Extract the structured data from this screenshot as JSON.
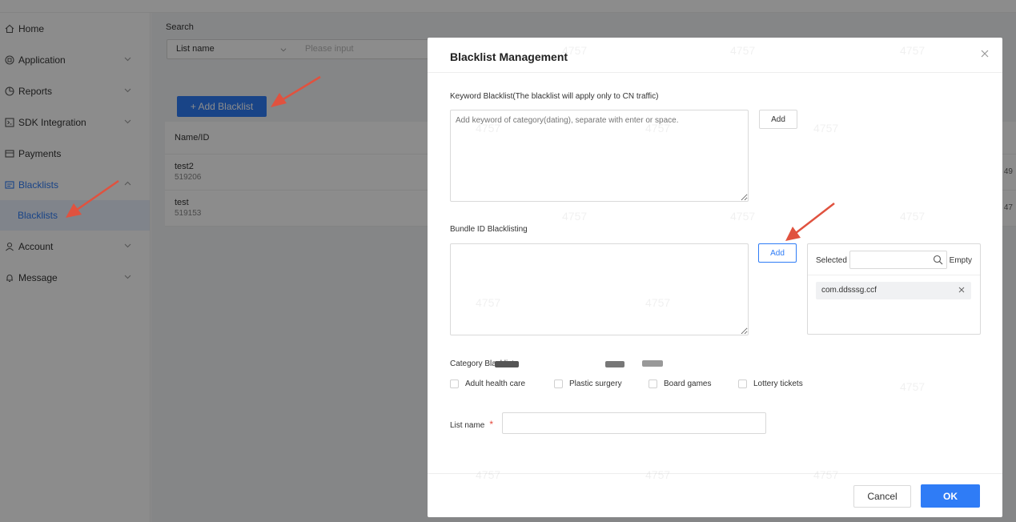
{
  "sidebar": {
    "items": [
      {
        "label": "Home",
        "icon": "home-icon"
      },
      {
        "label": "Application",
        "icon": "app-icon"
      },
      {
        "label": "Reports",
        "icon": "reports-icon"
      },
      {
        "label": "SDK Integration",
        "icon": "sdk-icon"
      },
      {
        "label": "Payments",
        "icon": "payments-icon"
      },
      {
        "label": "Blacklists",
        "icon": "blacklist-icon"
      },
      {
        "label": "Account",
        "icon": "account-icon"
      },
      {
        "label": "Message",
        "icon": "bell-icon"
      }
    ],
    "sub_item": "Blacklists"
  },
  "main": {
    "search_label": "Search",
    "filter_select": "List name",
    "filter_placeholder": "Please input",
    "add_button": "+ Add Blacklist",
    "table": {
      "header": "Name/ID",
      "rows": [
        {
          "name": "test2",
          "id": "519206",
          "tail": "49"
        },
        {
          "name": "test",
          "id": "519153",
          "tail": "47"
        }
      ]
    }
  },
  "modal": {
    "title": "Blacklist Management",
    "keyword_label": "Keyword Blacklist(The blacklist will apply only to CN traffic)",
    "keyword_placeholder": "Add keyword of category(dating), separate with enter or space.",
    "keyword_add": "Add",
    "bundle_label": "Bundle ID Blacklisting",
    "bundle_add": "Add",
    "selected_label": "Selected",
    "empty_label": "Empty",
    "selected_tags": [
      "com.ddsssg.ccf"
    ],
    "category_label": "Category Blacklist",
    "categories": [
      "Adult health care",
      "Plastic surgery",
      "Board games",
      "Lottery tickets"
    ],
    "list_name_label": "List name",
    "required_mark": "*",
    "cancel": "Cancel",
    "ok": "OK"
  },
  "colors": {
    "accent": "#2f7cf6",
    "required": "#e5483b",
    "arrow": "#e0523f"
  }
}
